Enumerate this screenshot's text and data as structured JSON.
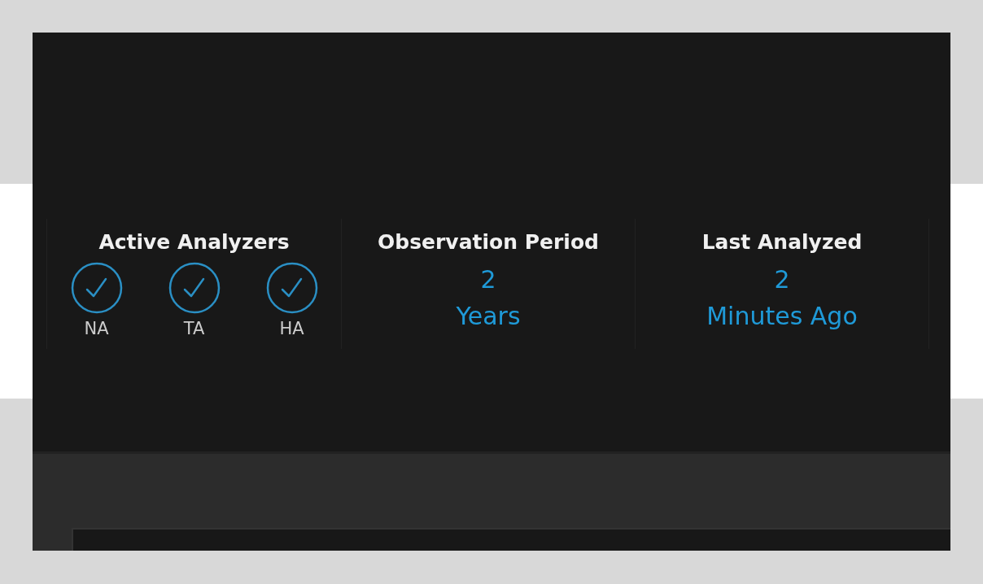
{
  "stats": [
    {
      "kind": "analyzers",
      "title": "Active Analyzers",
      "analyzers": [
        {
          "label": "NA",
          "checked": true
        },
        {
          "label": "TA",
          "checked": true
        },
        {
          "label": "HA",
          "checked": true
        }
      ]
    },
    {
      "kind": "value",
      "title": "Observation Period",
      "value": "2",
      "unit": "Years"
    },
    {
      "kind": "value",
      "title": "Last Analyzed",
      "value": "2",
      "unit": "Minutes Ago"
    }
  ]
}
